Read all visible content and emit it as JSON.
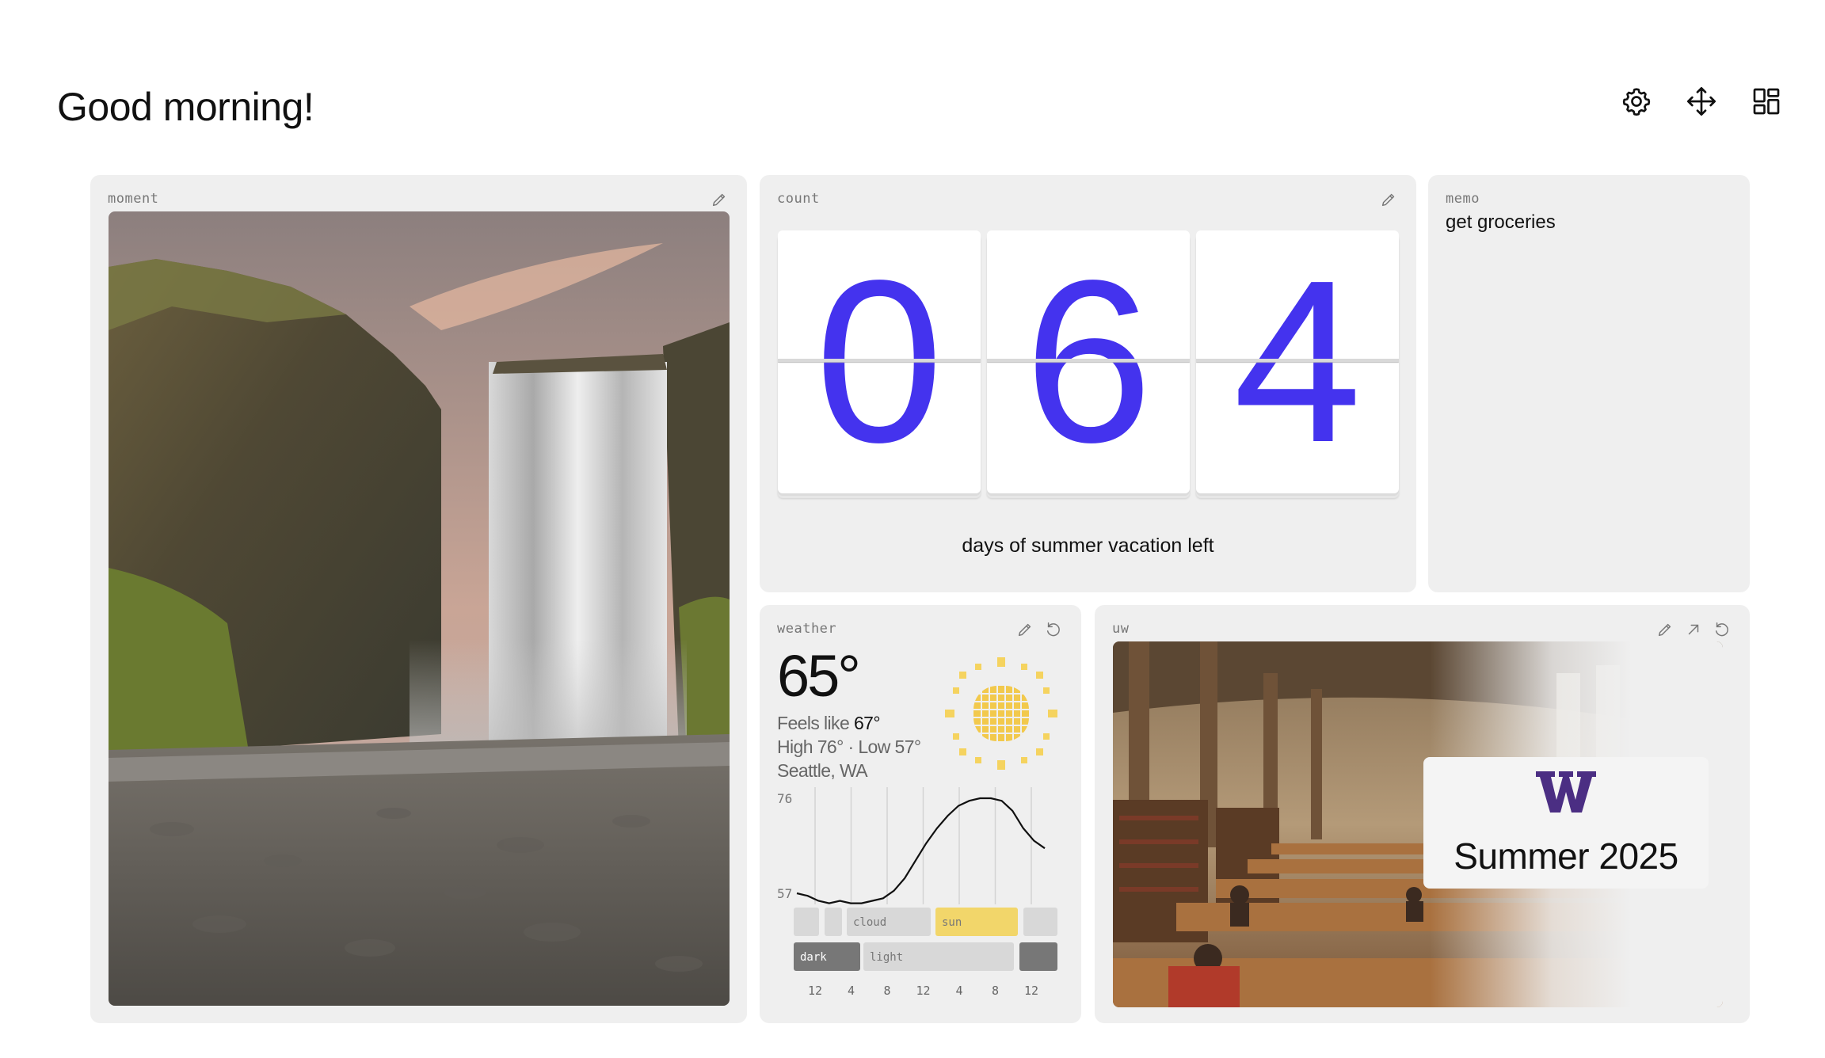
{
  "header": {
    "greeting": "Good morning!"
  },
  "toolbar": {
    "icons": [
      "gear-icon",
      "move-arrows-icon",
      "layout-grid-icon"
    ]
  },
  "moment": {
    "label": "moment",
    "image": "waterfall-photo"
  },
  "count": {
    "label": "count",
    "digits": [
      "0",
      "6",
      "4"
    ],
    "caption": "days of summer vacation left",
    "digit_color": "#4433ee"
  },
  "memo": {
    "label": "memo",
    "text": "get groceries"
  },
  "weather": {
    "label": "weather",
    "temp": "65°",
    "feels_label": "Feels like",
    "feels_value": "67°",
    "high_low": "High 76° · Low 57°",
    "location": "Seattle, WA",
    "chart_data": {
      "type": "line",
      "ylabels": [
        "76",
        "57"
      ],
      "ylim": [
        57,
        76
      ],
      "x": [
        0,
        1,
        2,
        3,
        4,
        5,
        6,
        7,
        8,
        9,
        10,
        11,
        12,
        13,
        14,
        15,
        16,
        17,
        18,
        19,
        20,
        21,
        22,
        23
      ],
      "values": [
        57,
        56.5,
        55.5,
        55,
        55.5,
        55,
        55,
        55.5,
        56,
        57.5,
        60,
        63.5,
        67,
        70,
        72.5,
        74.5,
        75.5,
        76,
        76,
        75.5,
        73.5,
        70,
        67.5,
        66
      ],
      "xticks": [
        "12",
        "4",
        "8",
        "12",
        "4",
        "8",
        "12"
      ],
      "condition_labels": [
        "cloud",
        "sun"
      ],
      "light_labels": [
        "dark",
        "light"
      ]
    }
  },
  "uw": {
    "label": "uw",
    "logo": "W",
    "title": "Summer 2025",
    "brand_color": "#4b2e83"
  }
}
